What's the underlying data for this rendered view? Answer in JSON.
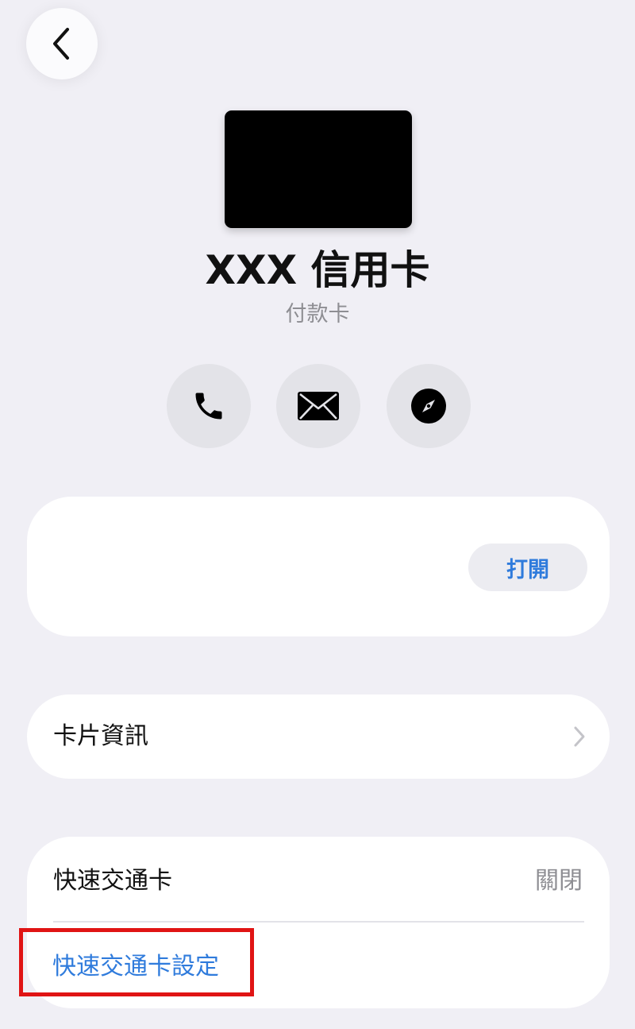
{
  "card": {
    "title": "XXX 信用卡",
    "subtitle": "付款卡"
  },
  "actions": {
    "phone_icon": "phone-icon",
    "mail_icon": "mail-icon",
    "safari_icon": "compass-icon"
  },
  "top_panel": {
    "open_label": "打開"
  },
  "card_info": {
    "label": "卡片資訊"
  },
  "express_transit": {
    "label": "快速交通卡",
    "value": "關閉",
    "settings_label": "快速交通卡設定"
  },
  "colors": {
    "background": "#f0eff5",
    "accent": "#2f7bdc",
    "highlight": "#e01414"
  }
}
